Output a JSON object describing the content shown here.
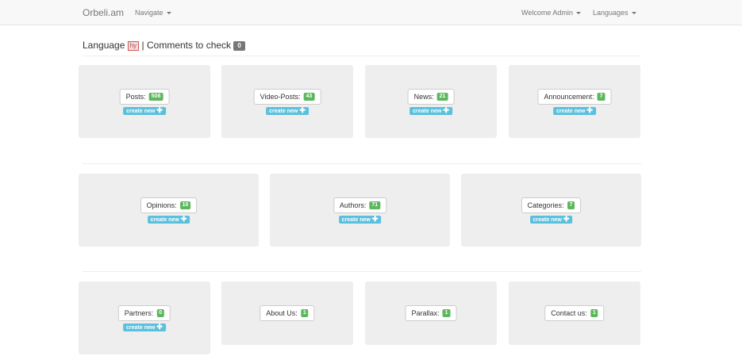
{
  "navbar": {
    "brand": "Orbeli.am",
    "navigate": "Navigate",
    "welcome": "Welcome Admin",
    "languages": "Languages"
  },
  "heading": {
    "language_label": "Language",
    "language_code": "hy",
    "separator": "|",
    "comments_label": "Comments to check",
    "comments_count": "0"
  },
  "create_label": "create new",
  "tiles": [
    {
      "label": "Posts:",
      "count": "508"
    },
    {
      "label": "Video-Posts:",
      "count": "43"
    },
    {
      "label": "News:",
      "count": "21"
    },
    {
      "label": "Announcement:",
      "count": "7"
    },
    {
      "label": "Opinions:",
      "count": "10"
    },
    {
      "label": "Authors:",
      "count": "71"
    },
    {
      "label": "Categories:",
      "count": "7"
    },
    {
      "label": "Partners:",
      "count": "0"
    },
    {
      "label": "About Us:",
      "count": "1"
    },
    {
      "label": "Parallax:",
      "count": "1"
    },
    {
      "label": "Contact us:",
      "count": "1"
    }
  ]
}
